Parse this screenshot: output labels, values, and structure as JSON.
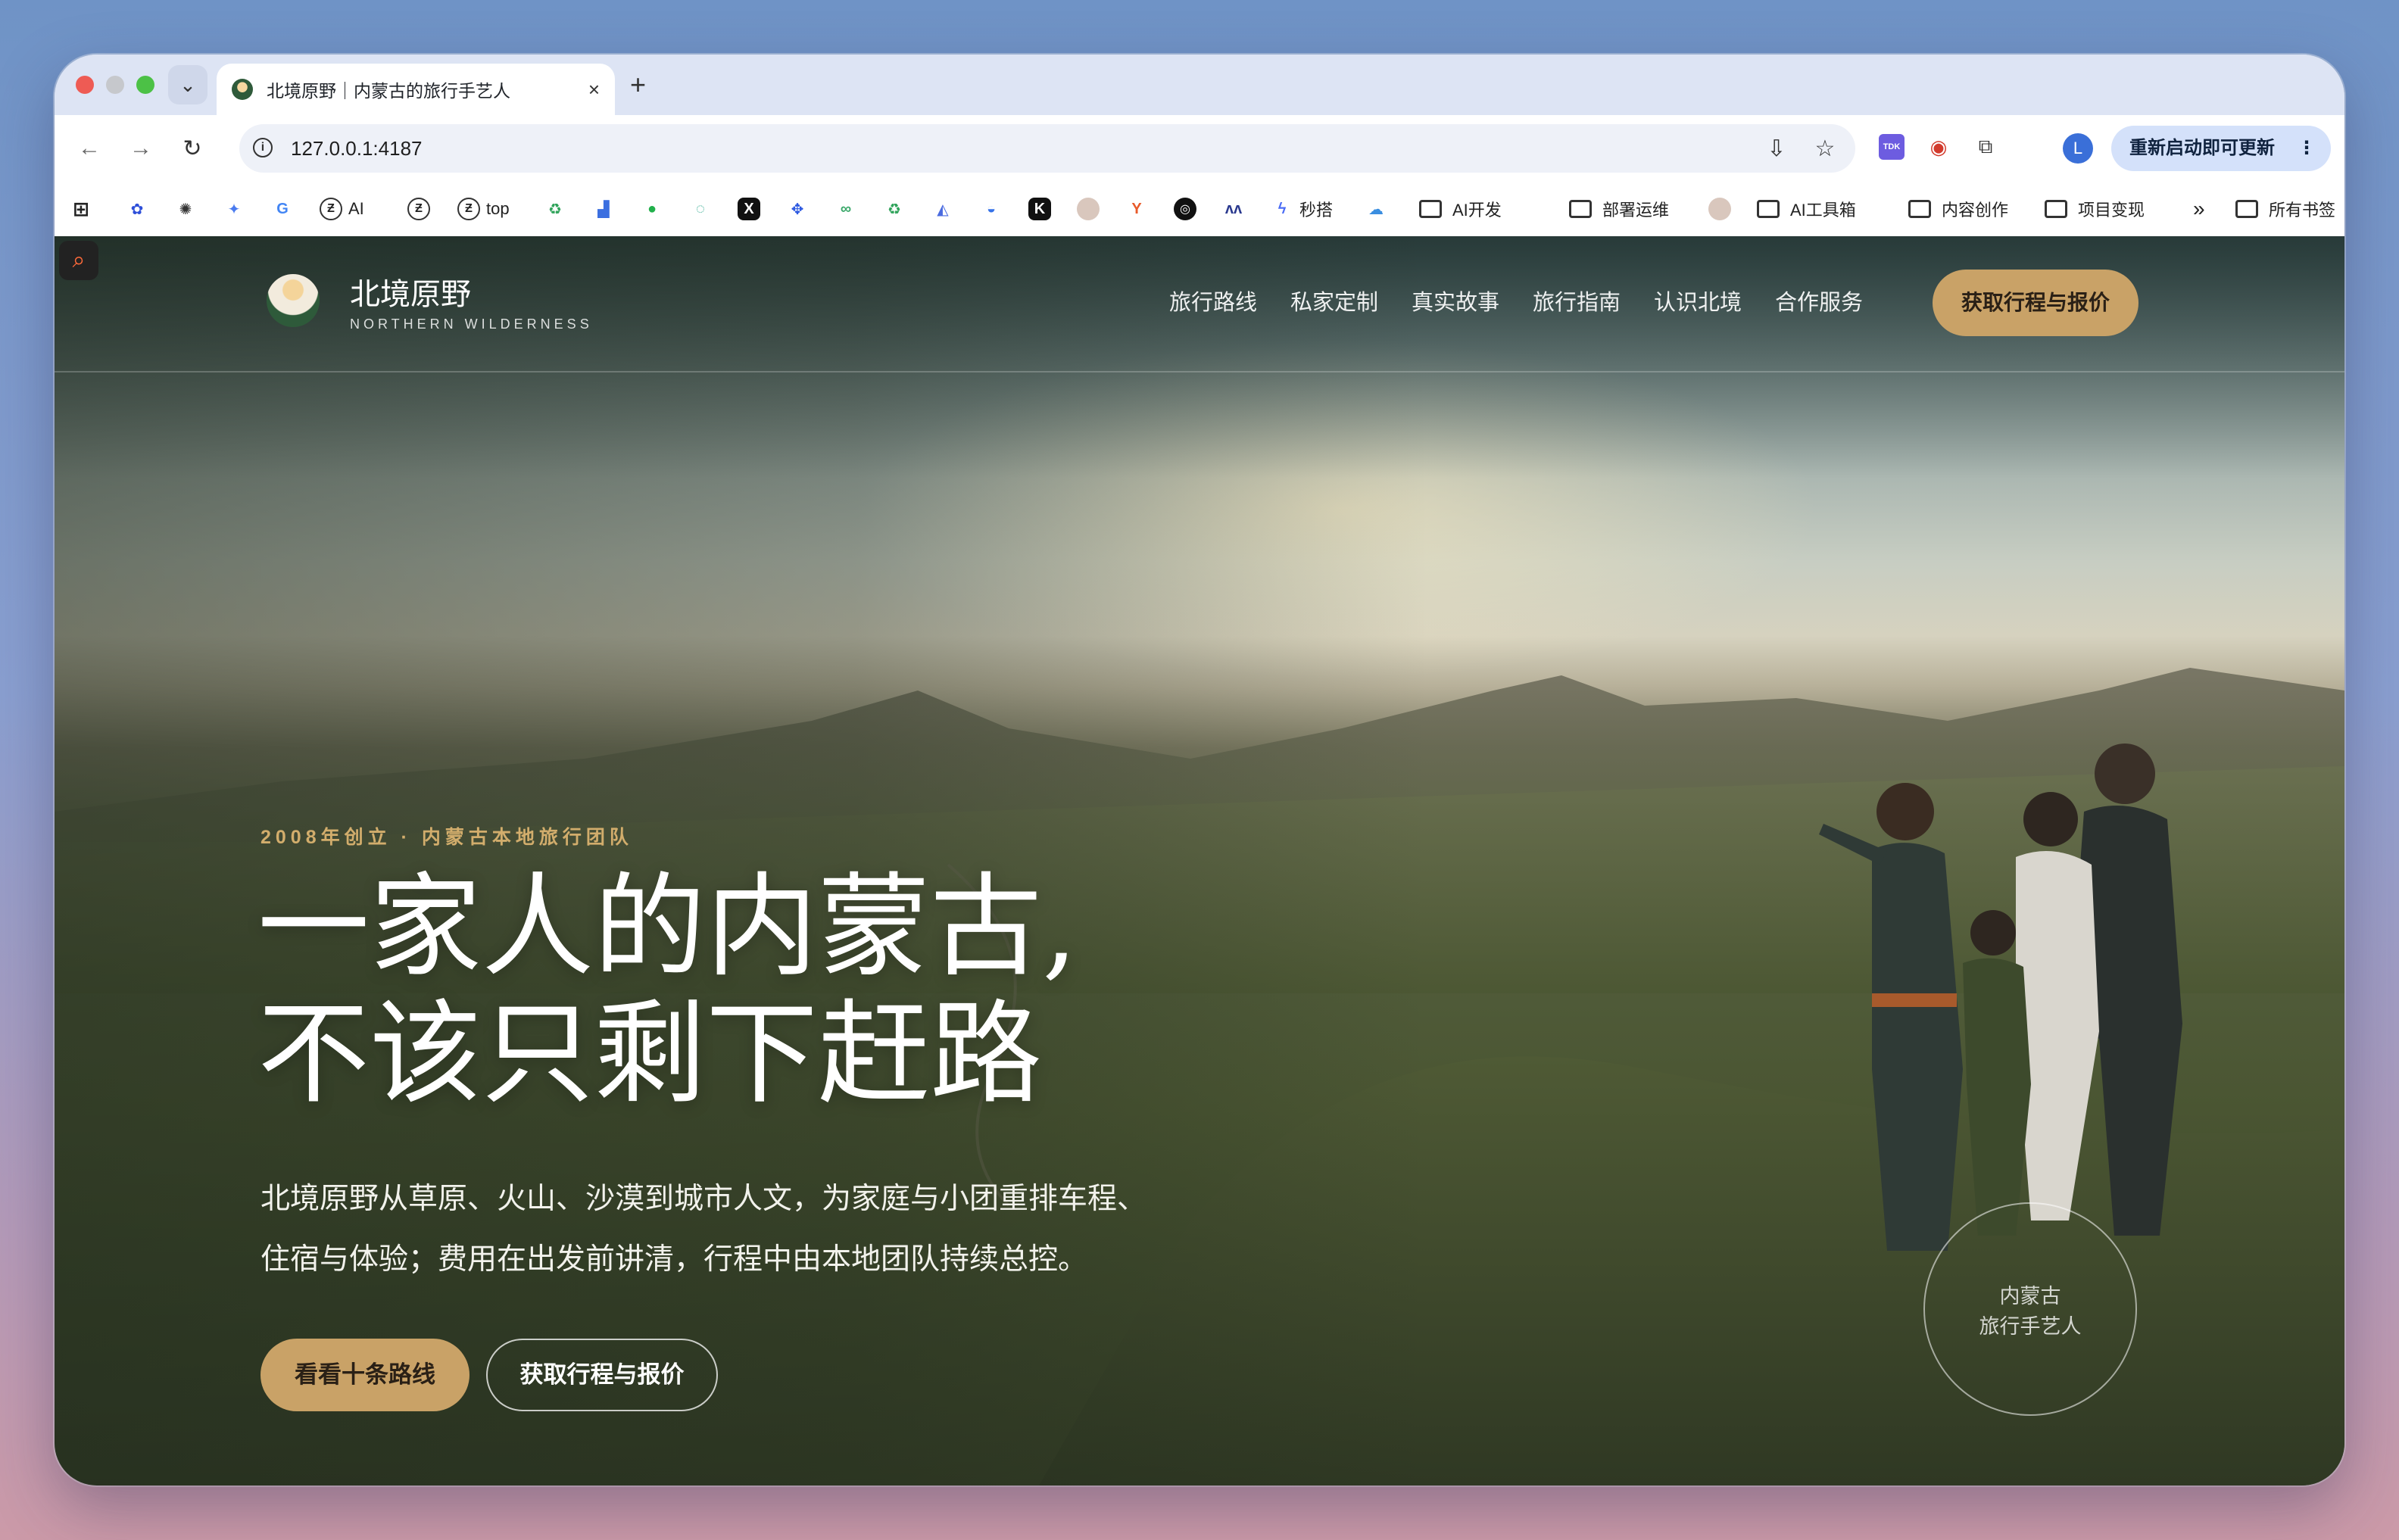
{
  "browser": {
    "tab_title": "北境原野｜内蒙古的旅行手艺人",
    "tab_close": "×",
    "new_tab": "+",
    "url": "127.0.0.1:4187",
    "profile_initial": "L",
    "update_label": "重新启动即可更新",
    "update_menu": "⋮",
    "nav": {
      "back": "←",
      "forward": "→",
      "reload": "↻",
      "tab_menu": "⌄"
    },
    "omnibox_actions": {
      "install": "⇩",
      "bookmark": "☆"
    },
    "extensions": {
      "tdk": "TDK",
      "ext2": "◉",
      "puzzle": "⧉"
    }
  },
  "bookmarks": {
    "items": [
      {
        "label": "AI",
        "icon": "zhihu-icon"
      },
      {
        "label": "top",
        "icon": "zhihu-icon"
      },
      {
        "label": "秒搭",
        "icon": "app-icon"
      },
      {
        "label": "AI开发",
        "icon": "folder-icon"
      },
      {
        "label": "部署运维",
        "icon": "folder-icon"
      },
      {
        "label": "AI工具箱",
        "icon": "folder-icon"
      },
      {
        "label": "内容创作",
        "icon": "folder-icon"
      },
      {
        "label": "项目变现",
        "icon": "folder-icon"
      }
    ],
    "overflow": "»",
    "all_bookmarks": "所有书签",
    "icon_glyphs": {
      "google": "G",
      "zhihu": "Ƶ",
      "x": "X",
      "k": "K"
    }
  },
  "site": {
    "brand": {
      "name": "北境原野",
      "subtitle": "NORTHERN WILDERNESS"
    },
    "nav": [
      "旅行路线",
      "私家定制",
      "真实故事",
      "旅行指南",
      "认识北境",
      "合作服务"
    ],
    "header_cta": "获取行程与报价",
    "eyebrow": "2008年创立 · 内蒙古本地旅行团队",
    "headline": {
      "line1": "一家人的内蒙古,",
      "line2": "不该只剩下赶路"
    },
    "subtext": {
      "line1": "北境原野从草原、火山、沙漠到城市人文，为家庭与小团重排车程、",
      "line2": "住宿与体验；费用在出发前讲清，行程中由本地团队持续总控。"
    },
    "primary_button": "看看十条路线",
    "secondary_button": "获取行程与报价",
    "badge": {
      "line1": "内蒙古",
      "line2": "旅行手艺人"
    }
  },
  "colors": {
    "accent_gold": "#c9a267",
    "eyebrow_gold": "#d2ad6c",
    "update_pill": "#d4e1fa"
  }
}
